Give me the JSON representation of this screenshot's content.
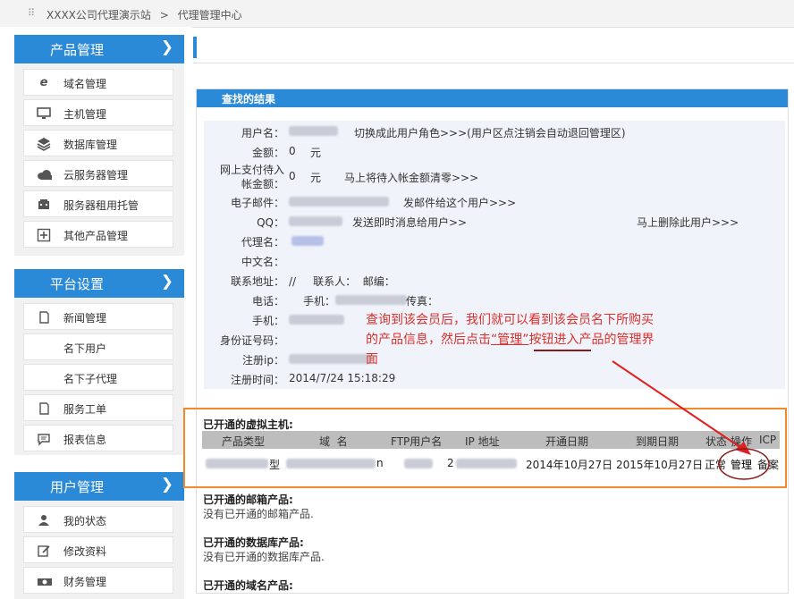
{
  "breadcrumb": {
    "site": "XXXX公司代理演示站",
    "sep": ">",
    "current": "代理管理中心"
  },
  "sidebar": {
    "sections": [
      {
        "title": "产品管理",
        "items": [
          {
            "label": "域名管理",
            "icon": "domain-e-icon"
          },
          {
            "label": "主机管理",
            "icon": "monitor-icon"
          },
          {
            "label": "数据库管理",
            "icon": "layers-icon"
          },
          {
            "label": "云服务器管理",
            "icon": "cloud-icon"
          },
          {
            "label": "服务器租用托管",
            "icon": "server-icon"
          },
          {
            "label": "其他产品管理",
            "icon": "plus-box-icon"
          }
        ]
      },
      {
        "title": "平台设置",
        "items": [
          {
            "label": "新闻管理",
            "icon": "document-icon"
          },
          {
            "label": "名下用户",
            "icon": ""
          },
          {
            "label": "名下子代理",
            "icon": ""
          },
          {
            "label": "服务工单",
            "icon": "document-icon"
          },
          {
            "label": "报表信息",
            "icon": "chat-icon"
          }
        ]
      },
      {
        "title": "用户管理",
        "items": [
          {
            "label": "我的状态",
            "icon": "user-icon"
          },
          {
            "label": "修改资料",
            "icon": "edit-icon"
          },
          {
            "label": "财务管理",
            "icon": "money-icon"
          }
        ]
      }
    ]
  },
  "panel": {
    "title": "查找的结果",
    "fields": {
      "username": "用户名：",
      "switch_link": "切换成此用户角色>>>(用户区点注销会自动退回管理区)",
      "balance_label": "金额：",
      "balance_value": "0",
      "currency": "元",
      "pending_label_1": "网上支付待入",
      "pending_label_2": "帐金额：",
      "pending_value": "0",
      "pending_link": "马上将待入帐金额清零>>>",
      "email_label": "电子邮件：",
      "email_link": "发邮件给这个用户>>>",
      "qq_label": "QQ：",
      "qq_link": "发送即时消息给用户>>",
      "delete_link": "马上删除此用户>>>",
      "agent_label": "代理名：",
      "cn_name_label": "中文名：",
      "address_label": "联系地址：",
      "address_value": "//     联系人：  邮编：",
      "phone_label": "电话：",
      "phone_value": "手机：",
      "fax_value": "传真：",
      "mobile_label": "手机：",
      "id_label": "身份证号码：",
      "ip_label": "注册ip：",
      "regtime_label": "注册时间：",
      "regtime_value": "2014/7/24 15:18:29"
    },
    "note": {
      "line1": "查询到该会员后，我们就可以看到该会员名下所购买",
      "line2a": "的产品信息，然后点击",
      "line2b": "“管理”",
      "line2c": "按钮进入产品的管理界",
      "line3": "面"
    },
    "hosting": {
      "title": "已开通的虚拟主机:",
      "headers": [
        "产品类型",
        "域  名",
        "FTP用户名",
        "IP 地址",
        "开通日期",
        "到期日期",
        "状态",
        "操作",
        "ICP"
      ],
      "row": {
        "type_suffix": "型",
        "domain_suffix": "n",
        "ip_prefix": "2",
        "open_date": "2014年10月27日",
        "expire_date": "2015年10月27日",
        "status": "正常",
        "action": "管理",
        "icp": "备案"
      }
    },
    "mailbox": {
      "title": "已开通的邮箱产品:",
      "empty": "没有已开通的邮箱产品."
    },
    "database": {
      "title": "已开通的数据库产品:",
      "empty": "没有已开通的数据库产品."
    },
    "domains": {
      "title": "已开通的域名产品:"
    }
  },
  "colors": {
    "accent": "#2a8ad8",
    "annotation": "#d9302c",
    "highlight_box": "#f08a2a"
  }
}
